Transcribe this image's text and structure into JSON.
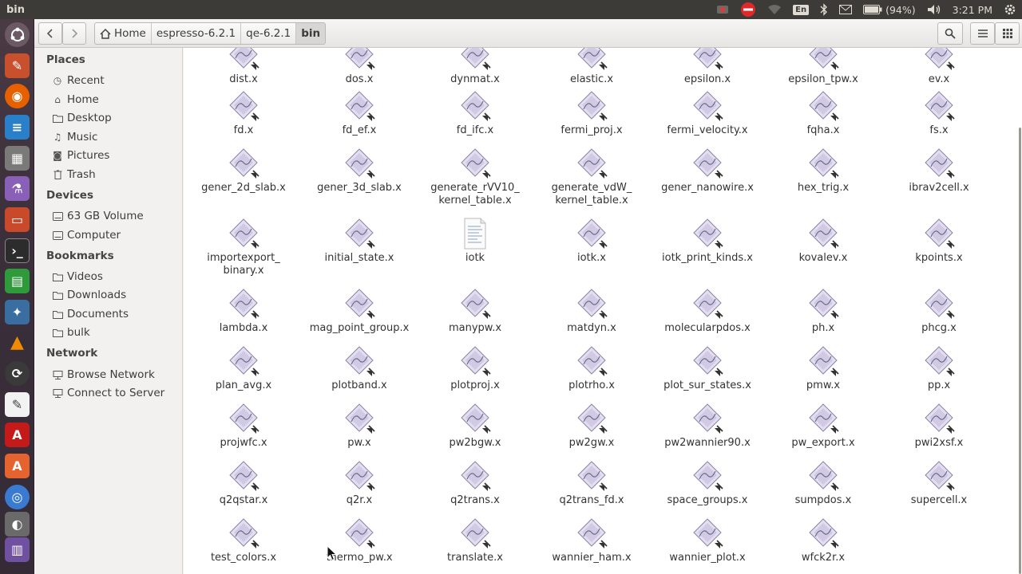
{
  "window": {
    "title": "bin"
  },
  "tray": {
    "keyboard_lang": "En",
    "battery": "(94%)",
    "time": "3:21 PM"
  },
  "breadcrumb": [
    "Home",
    "espresso-6.2.1",
    "qe-6.2.1",
    "bin"
  ],
  "sidebar": {
    "places_heading": "Places",
    "places": [
      {
        "label": "Recent",
        "icon": "clock-icon"
      },
      {
        "label": "Home",
        "icon": "home-icon"
      },
      {
        "label": "Desktop",
        "icon": "folder-icon"
      },
      {
        "label": "Music",
        "icon": "music-icon"
      },
      {
        "label": "Pictures",
        "icon": "camera-icon"
      },
      {
        "label": "Trash",
        "icon": "trash-icon"
      }
    ],
    "devices_heading": "Devices",
    "devices": [
      {
        "label": "63 GB Volume",
        "icon": "drive-icon"
      },
      {
        "label": "Computer",
        "icon": "drive-icon"
      }
    ],
    "bookmarks_heading": "Bookmarks",
    "bookmarks": [
      {
        "label": "Videos",
        "icon": "folder-icon"
      },
      {
        "label": "Downloads",
        "icon": "folder-icon"
      },
      {
        "label": "Documents",
        "icon": "folder-icon"
      },
      {
        "label": "bulk",
        "icon": "folder-icon"
      }
    ],
    "network_heading": "Network",
    "network": [
      {
        "label": "Browse Network",
        "icon": "network-icon"
      },
      {
        "label": "Connect to Server",
        "icon": "server-icon"
      }
    ]
  },
  "files": [
    [
      "dist.x",
      "dos.x",
      "dynmat.x",
      "elastic.x",
      "epsilon.x",
      "epsilon_tpw.x",
      "ev.x"
    ],
    [
      "fd.x",
      "fd_ef.x",
      "fd_ifc.x",
      "fermi_proj.x",
      "fermi_velocity.x",
      "fqha.x",
      "fs.x"
    ],
    [
      "gener_2d_slab.x",
      "gener_3d_slab.x",
      "generate_rVV10_\nkernel_table.x",
      "generate_vdW_\nkernel_table.x",
      "gener_nanowire.x",
      "hex_trig.x",
      "ibrav2cell.x"
    ],
    [
      "importexport_\nbinary.x",
      "initial_state.x",
      "iotk",
      "iotk.x",
      "iotk_print_kinds.x",
      "kovalev.x",
      "kpoints.x"
    ],
    [
      "lambda.x",
      "mag_point_group.x",
      "manypw.x",
      "matdyn.x",
      "molecularpdos.x",
      "ph.x",
      "phcg.x"
    ],
    [
      "plan_avg.x",
      "plotband.x",
      "plotproj.x",
      "plotrho.x",
      "plot_sur_states.x",
      "pmw.x",
      "pp.x"
    ],
    [
      "projwfc.x",
      "pw.x",
      "pw2bgw.x",
      "pw2gw.x",
      "pw2wannier90.x",
      "pw_export.x",
      "pwi2xsf.x"
    ],
    [
      "q2qstar.x",
      "q2r.x",
      "q2trans.x",
      "q2trans_fd.x",
      "space_groups.x",
      "sumpdos.x",
      "supercell.x"
    ],
    [
      "test_colors.x",
      "thermo_pw.x",
      "translate.x",
      "wannier_ham.x",
      "wannier_plot.x",
      "wfck2r.x"
    ]
  ],
  "text_files": [
    "iotk"
  ]
}
